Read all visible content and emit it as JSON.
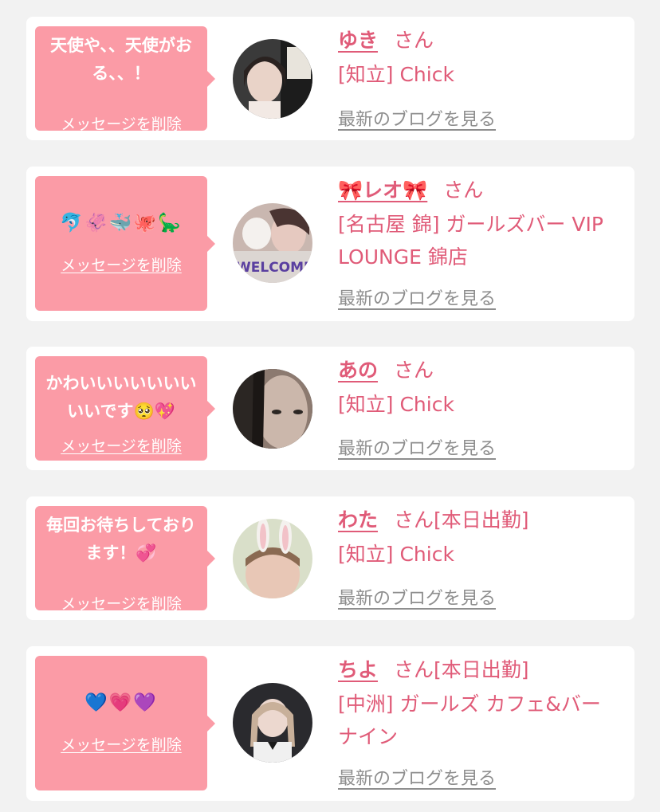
{
  "delete_label": "メッセージを削除",
  "blog_label": "最新のブログを見る",
  "san_label": "さん",
  "colors": {
    "background": "#f2f2f2",
    "card": "#ffffff",
    "bubble": "#fb9ba6",
    "accent": "#e05b78",
    "blog_link": "#8e8e8e"
  },
  "messages": [
    {
      "message": "天使や、、天使がおる、、！",
      "name": "ゆき",
      "status": "",
      "shop": "[知立] Chick"
    },
    {
      "message": "🐬🦑🐳🐙🦕",
      "name": "🎀レオ🎀",
      "status": "",
      "shop": "[名古屋 錦] ガールズバー VIP LOUNGE 錦店"
    },
    {
      "message": "かわいいいいいいいいいです🥺💖",
      "name": "あの",
      "status": "",
      "shop": "[知立] Chick"
    },
    {
      "message": "毎回お待ちしております！💞",
      "name": "わた",
      "status": "[本日出勤]",
      "shop": "[知立] Chick"
    },
    {
      "message": "💙💗💜",
      "name": "ちよ",
      "status": "[本日出勤]",
      "shop": "[中洲] ガールズ カフェ&バー ナイン"
    }
  ]
}
